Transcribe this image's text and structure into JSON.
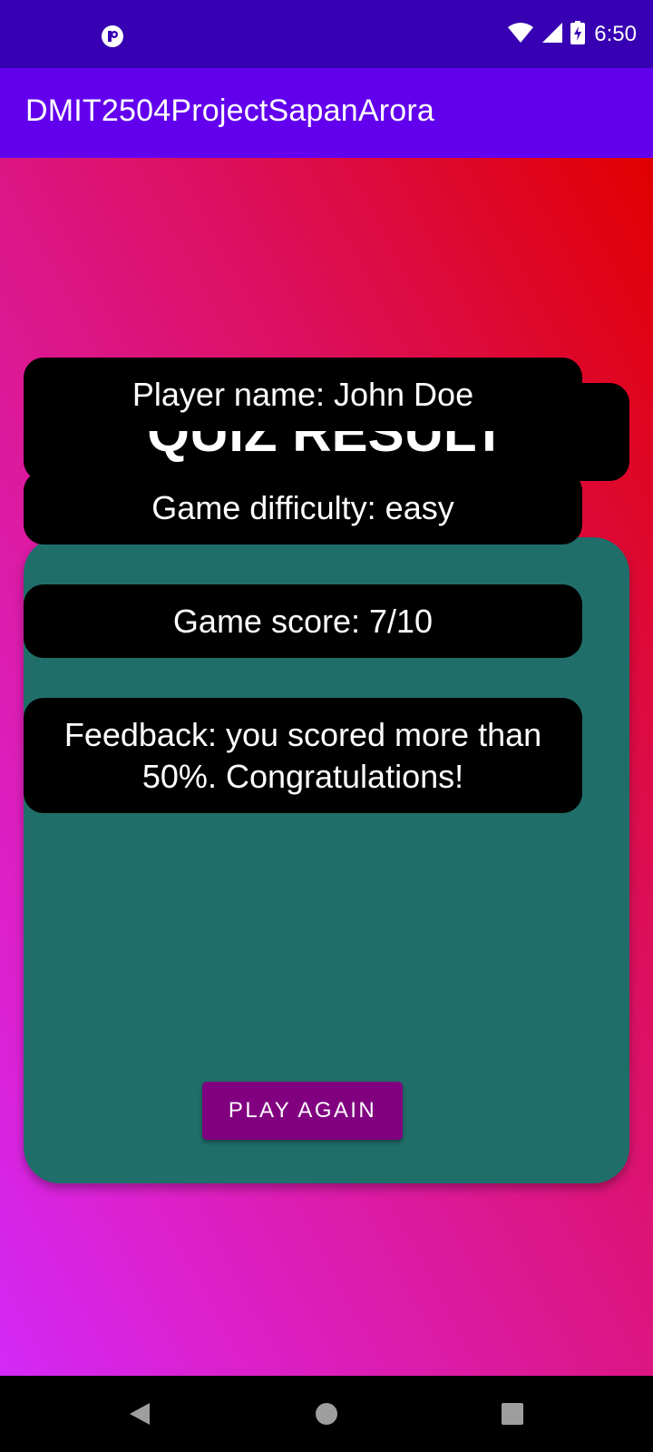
{
  "status_bar": {
    "time": "6:50",
    "left_icon": "app-notification-icon",
    "icons": [
      "wifi-icon",
      "cellular-signal-icon",
      "battery-charging-icon"
    ]
  },
  "app_bar": {
    "title": "DMIT2504ProjectSapanArora"
  },
  "quiz_result": {
    "title": "QUIZ RESULT",
    "player_name": "Player name: John Doe",
    "difficulty": "Game difficulty: easy",
    "score": "Game score: 7/10",
    "feedback": "Feedback: you scored more than 50%. Congratulations!",
    "play_again_label": "PLAY AGAIN"
  },
  "nav_bar": {
    "icons": [
      "back-icon",
      "home-icon",
      "recents-icon"
    ]
  },
  "colors": {
    "status_bar": "#3700B3",
    "app_bar": "#6200EE",
    "card": "#206E6A",
    "button": "#800080",
    "gradient_top": "#E00000",
    "gradient_bottom": "#D428F8"
  }
}
